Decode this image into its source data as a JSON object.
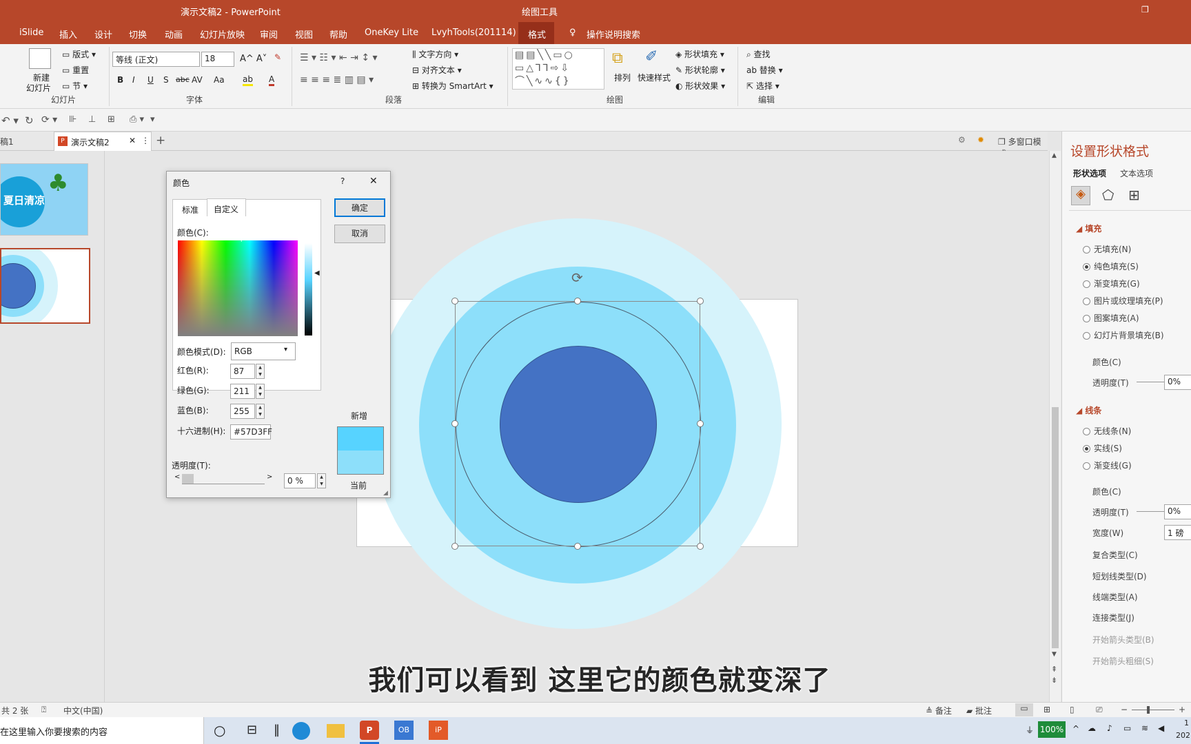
{
  "titlebar": {
    "doc_title": "演示文稿2  -  PowerPoint",
    "context_tool": "绘图工具",
    "restore_icon": "restore-icon"
  },
  "tabs": [
    {
      "label": "iSlide"
    },
    {
      "label": "插入"
    },
    {
      "label": "设计"
    },
    {
      "label": "切换"
    },
    {
      "label": "动画"
    },
    {
      "label": "幻灯片放映"
    },
    {
      "label": "审阅"
    },
    {
      "label": "视图"
    },
    {
      "label": "帮助"
    },
    {
      "label": "OneKey Lite"
    },
    {
      "label": "LvyhTools(201114)"
    },
    {
      "label": "格式"
    }
  ],
  "search": {
    "label": "操作说明搜索"
  },
  "ribbon": {
    "slides": {
      "new_slide": "新建",
      "new_slide2": "幻灯片",
      "layout": "版式",
      "reset": "重置",
      "section": "节",
      "group": "幻灯片"
    },
    "font": {
      "name": "等线 (正文)",
      "size": "18",
      "group": "字体",
      "b": "B",
      "i": "I",
      "u": "U",
      "s": "S",
      "abc": "abc",
      "av": "AV",
      "aa": "Aa",
      "color_a": "A"
    },
    "paragraph": {
      "text_dir": "文字方向",
      "align_text": "对齐文本",
      "smartart": "转换为 SmartArt",
      "group": "段落"
    },
    "drawing": {
      "arrange": "排列",
      "quick_styles": "快速样式",
      "fill": "形状填充",
      "outline": "形状轮廓",
      "effects": "形状效果",
      "group": "绘图"
    },
    "editing": {
      "find": "查找",
      "replace": "替换",
      "select": "选择",
      "group": "编辑"
    }
  },
  "doctabs": {
    "tab1": "稿1",
    "tab2": "演示文稿2",
    "add": "+",
    "multiwindow": "多窗口模式"
  },
  "thumbs": {
    "slide1_text": "夏日清凉"
  },
  "dialog": {
    "title": "颜色",
    "help": "?",
    "close": "✕",
    "tab_standard": "标准",
    "tab_custom": "自定义",
    "colors_label": "颜色(C):",
    "model_label": "颜色模式(D):",
    "model_value": "RGB",
    "red_label": "红色(R):",
    "red": "87",
    "green_label": "绿色(G):",
    "green": "211",
    "blue_label": "蓝色(B):",
    "blue": "255",
    "hex_label": "十六进制(H):",
    "hex": "#57D3FF",
    "transparency_label": "透明度(T):",
    "transparency": "0 %",
    "ok": "确定",
    "cancel": "取消",
    "new_label": "新增",
    "current_label": "当前",
    "new_color": "#57D3FF",
    "current_color": "#8DDFFA"
  },
  "pane": {
    "title": "设置形状格式",
    "tab_shape": "形状选项",
    "tab_text": "文本选项",
    "fill_header": "填充",
    "fill_options": [
      "无填充(N)",
      "纯色填充(S)",
      "渐变填充(G)",
      "图片或纹理填充(P)",
      "图案填充(A)",
      "幻灯片背景填充(B)"
    ],
    "fill_selected": 1,
    "color_label": "颜色(C)",
    "transparency_label": "透明度(T)",
    "transparency": "0%",
    "line_header": "线条",
    "line_options": [
      "无线条(N)",
      "实线(S)",
      "渐变线(G)"
    ],
    "line_selected": 1,
    "line_color_label": "颜色(C)",
    "line_transparency_label": "透明度(T)",
    "line_transparency": "0%",
    "width_label": "宽度(W)",
    "width": "1 磅",
    "compound_label": "复合类型(C)",
    "dash_label": "短划线类型(D)",
    "cap_label": "线端类型(A)",
    "join_label": "连接类型(J)",
    "begin_arrow_label": "开始箭头类型(B)",
    "begin_arrow_size_label": "开始箭头粗细(S)"
  },
  "status": {
    "slides": "共 2 张",
    "lang": "中文(中国)",
    "notes": "备注",
    "comments": "批注"
  },
  "taskbar": {
    "search_placeholder": "在这里输入你要搜索的内容",
    "battery": "100%",
    "time": "1",
    "date": "202"
  },
  "subtitle": "我们可以看到 这里它的颜色就变深了",
  "colors": {
    "accent": "#B7472A",
    "outer_ring": "#D6F3FB",
    "middle_ring": "#8DDFFA",
    "inner_circle": "#4472C4"
  }
}
